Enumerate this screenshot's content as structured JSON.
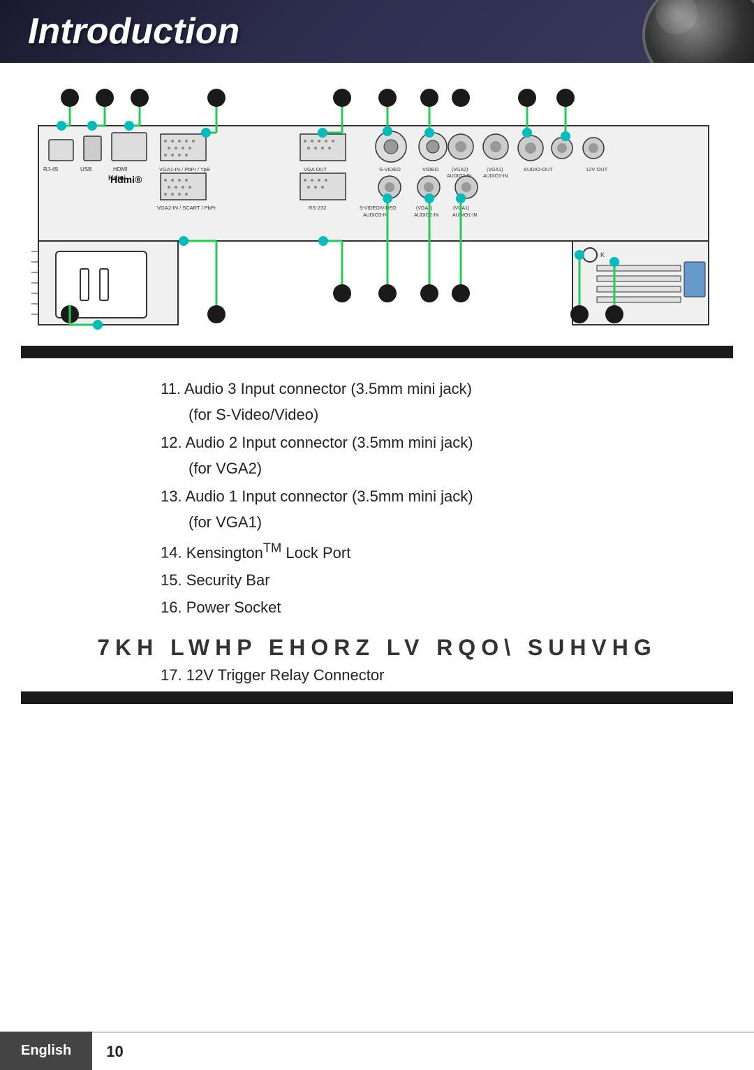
{
  "header": {
    "title": "Introduction",
    "lens_alt": "projector lens"
  },
  "diagram": {
    "description": "Projector rear panel diagram with labeled connectors",
    "connectors": [
      "RJ-45",
      "USB",
      "HDMI",
      "VGA1-IN / PbPr / YPb",
      "VGA2-IN / SCART / PbPr",
      "VGA OUT",
      "S-VIDEO",
      "VIDEO",
      "RS-232",
      "AUDIO-OUT",
      "S-VIDEO/VIDEO AUDIO3-IN",
      "VGA2 AUDIO2-IN",
      "VGA1 AUDIO1-IN",
      "12V OUT"
    ]
  },
  "items": [
    {
      "number": "11.",
      "text": "Audio 3 Input connector (3.5mm mini jack)",
      "sub": "(for S-Video/Video)"
    },
    {
      "number": "12.",
      "text": "Audio 2 Input connector (3.5mm mini jack)",
      "sub": "(for VGA2)"
    },
    {
      "number": "13.",
      "text": "Audio 1 Input connector (3.5mm mini jack)",
      "sub": "(for VGA1)"
    },
    {
      "number": "14.",
      "text": "Kensington™ Lock Port",
      "sub": ""
    },
    {
      "number": "15.",
      "text": "Security Bar",
      "sub": ""
    },
    {
      "number": "16.",
      "text": "Power Socket",
      "sub": ""
    }
  ],
  "highlight_text": "7KH  LWHP  EHORZ  LV  RQO\\  SUHVHG",
  "item_17": {
    "number": "17.",
    "text": "12V Trigger Relay Connector"
  },
  "footer": {
    "language": "English",
    "page": "10"
  }
}
